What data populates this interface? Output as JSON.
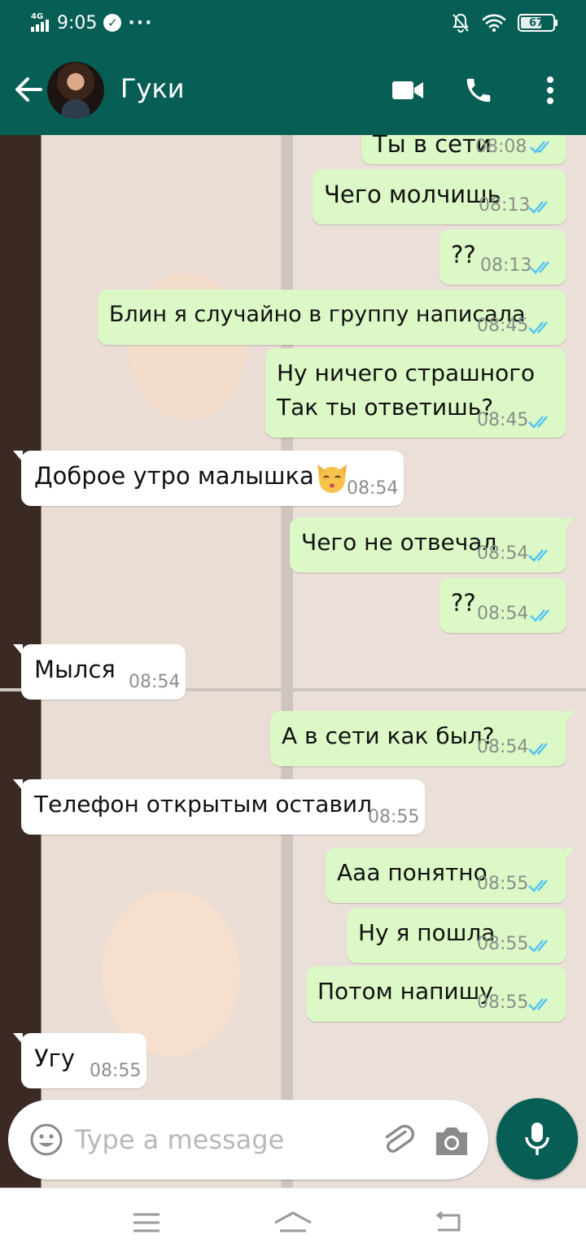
{
  "status_bar": {
    "network": "4G",
    "time": "9:05",
    "more": "···",
    "battery": "67",
    "battery_level_percent": 67
  },
  "header": {
    "contact_name": "Гуки",
    "icons": [
      "back-arrow-icon",
      "avatar",
      "video-call-icon",
      "phone-icon",
      "more-vert-icon"
    ]
  },
  "messages": [
    {
      "direction": "out",
      "text": "Ты в сети",
      "time": "08:08",
      "status": "read"
    },
    {
      "direction": "out",
      "text": "Чего молчишь",
      "time": "08:13",
      "status": "read"
    },
    {
      "direction": "out",
      "text": "??",
      "time": "08:13",
      "status": "read"
    },
    {
      "direction": "out",
      "text": "Блин я случайно в группу написала",
      "time": "08:45",
      "status": "read"
    },
    {
      "direction": "out",
      "text": "Ну ничего страшного\nТак ты ответишь?",
      "time": "08:45",
      "status": "read"
    },
    {
      "direction": "in",
      "text": "Доброе утро малышка",
      "emoji": "kissing-cat",
      "time": "08:54"
    },
    {
      "direction": "out",
      "text": "Чего не отвечал",
      "time": "08:54",
      "status": "read"
    },
    {
      "direction": "out",
      "text": "??",
      "time": "08:54",
      "status": "read"
    },
    {
      "direction": "in",
      "text": "Мылся",
      "time": "08:54"
    },
    {
      "direction": "out",
      "text": "А в сети как был?",
      "time": "08:54",
      "status": "read"
    },
    {
      "direction": "in",
      "text": "Телефон открытым оставил",
      "time": "08:55"
    },
    {
      "direction": "out",
      "text": "Ааа понятно",
      "time": "08:55",
      "status": "read"
    },
    {
      "direction": "out",
      "text": "Ну я пошла",
      "time": "08:55",
      "status": "read"
    },
    {
      "direction": "out",
      "text": "Потом напишу",
      "time": "08:55",
      "status": "read"
    },
    {
      "direction": "in",
      "text": "Угу",
      "time": "08:55"
    }
  ],
  "composer": {
    "placeholder": "Type a message",
    "value": ""
  },
  "colors": {
    "header": "#075e54",
    "outgoing_bubble": "#dcf8c6",
    "incoming_bubble": "#ffffff",
    "read_ticks": "#4fc3f7"
  }
}
